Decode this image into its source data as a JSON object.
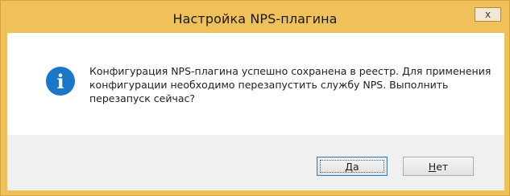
{
  "window": {
    "title": "Настройка NPS-плагина",
    "close_glyph": "x"
  },
  "message": {
    "icon": "info-icon",
    "text": "Конфигурация NPS-плагина успешно сохранена в реестр. Для применения конфигурации необходимо перезапустить службу NPS. Выполнить перезапуск сейчас?"
  },
  "buttons": {
    "yes": {
      "mnemonic": "Д",
      "rest": "а"
    },
    "no": {
      "mnemonic": "Н",
      "rest": "ет"
    }
  },
  "colors": {
    "frame": "#f0c15a",
    "info_icon": "#1a76c7",
    "footer": "#f0f0f0"
  }
}
